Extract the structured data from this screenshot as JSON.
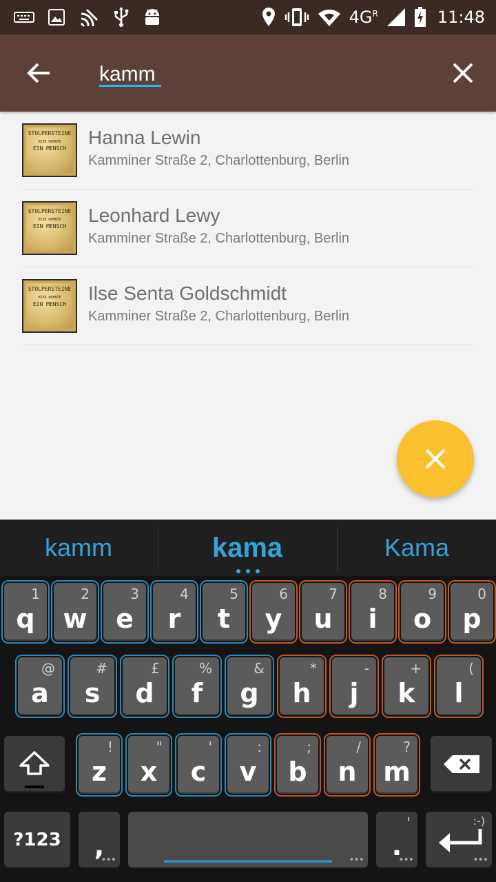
{
  "status_bar": {
    "left_icons": [
      "keyboard-icon",
      "image-icon",
      "cast-icon",
      "usb-icon",
      "android-icon"
    ],
    "right_icons": [
      "location-icon",
      "vibrate-icon",
      "wifi-icon",
      "signal-icon",
      "battery-charging-icon"
    ],
    "network": "4G",
    "network_sup": "R",
    "time": "11:48"
  },
  "toolbar": {
    "back_icon": "arrow-back-icon",
    "search_value": "kamm",
    "clear_icon": "close-icon",
    "background": "#5d4037",
    "underline_color": "#29b6f6"
  },
  "stone_text": {
    "line1": "STOLPERSTEINE",
    "line2": "HIER WOHNTE",
    "line3": "EIN MENSCH"
  },
  "results": [
    {
      "name": "Hanna Lewin",
      "address": "Kamminer Straße 2, Charlottenburg, Berlin"
    },
    {
      "name": "Leonhard Lewy",
      "address": "Kamminer Straße 2, Charlottenburg, Berlin"
    },
    {
      "name": "Ilse Senta Goldschmidt",
      "address": "Kamminer Straße 2, Charlottenburg, Berlin"
    }
  ],
  "fab": {
    "icon": "close-icon",
    "color": "#fbc02d"
  },
  "keyboard": {
    "suggestions": [
      "kamm",
      "kama",
      "Kama"
    ],
    "row1": [
      {
        "k": "q",
        "h": "1"
      },
      {
        "k": "w",
        "h": "2"
      },
      {
        "k": "e",
        "h": "3"
      },
      {
        "k": "r",
        "h": "4"
      },
      {
        "k": "t",
        "h": "5"
      },
      {
        "k": "y",
        "h": "6"
      },
      {
        "k": "u",
        "h": "7"
      },
      {
        "k": "i",
        "h": "8"
      },
      {
        "k": "o",
        "h": "9"
      },
      {
        "k": "p",
        "h": "0"
      }
    ],
    "row2": [
      {
        "k": "a",
        "h": "@"
      },
      {
        "k": "s",
        "h": "#"
      },
      {
        "k": "d",
        "h": "£"
      },
      {
        "k": "f",
        "h": "%"
      },
      {
        "k": "g",
        "h": "&"
      },
      {
        "k": "h",
        "h": "*"
      },
      {
        "k": "j",
        "h": "-"
      },
      {
        "k": "k",
        "h": "+"
      },
      {
        "k": "l",
        "h": "("
      }
    ],
    "row3": [
      {
        "k": "z",
        "h": "!"
      },
      {
        "k": "x",
        "h": "\""
      },
      {
        "k": "c",
        "h": "'"
      },
      {
        "k": "v",
        "h": ":"
      },
      {
        "k": "b",
        "h": ";"
      },
      {
        "k": "n",
        "h": "/"
      },
      {
        "k": "m",
        "h": "?"
      }
    ],
    "symbols_label": "?123",
    "comma": ",",
    "period": ".",
    "period_hint": "'",
    "enter_hint": ":-)",
    "shift_icon": "shift-icon",
    "backspace_icon": "backspace-icon",
    "enter_icon": "enter-icon",
    "accent_blue": "#2f88b5",
    "accent_orange": "#c1562a"
  }
}
